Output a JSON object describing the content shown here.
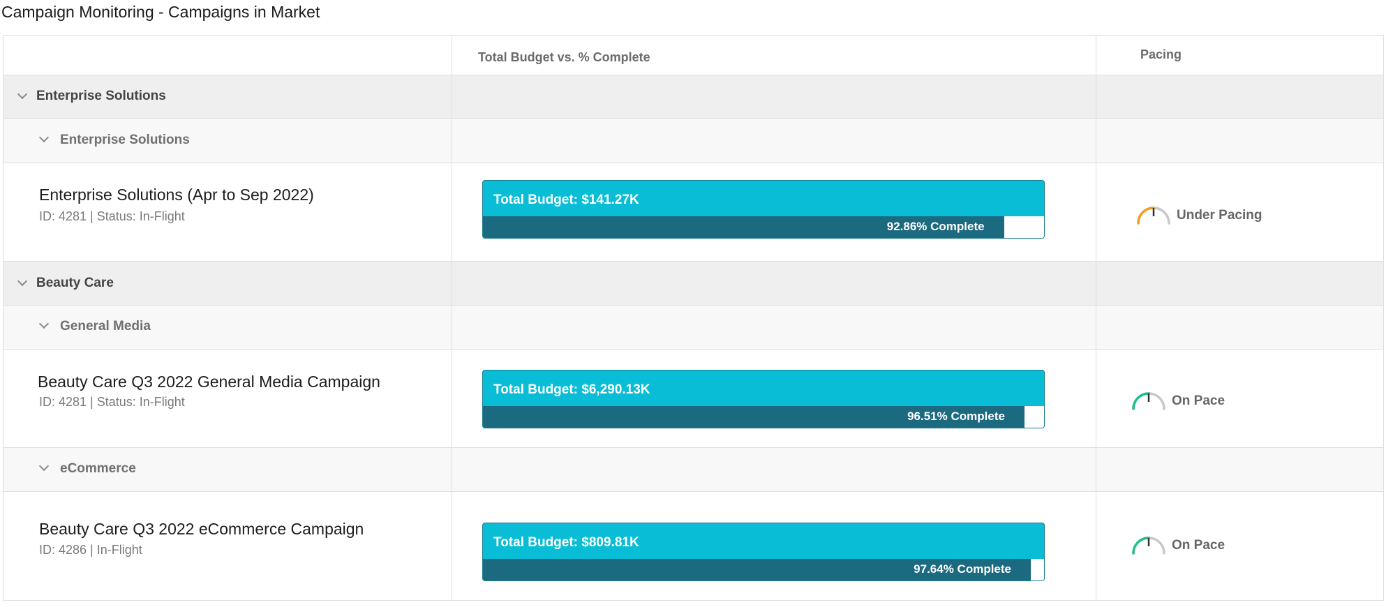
{
  "page": {
    "title": "Campaign Monitoring - Campaigns in Market"
  },
  "columns": {
    "budget_header": "Total Budget vs. % Complete",
    "pacing_header": "Pacing"
  },
  "groups": [
    {
      "label": "Enterprise Solutions",
      "subgroups": [
        {
          "label": "Enterprise Solutions",
          "campaigns": [
            {
              "name": "Enterprise Solutions (Apr to Sep 2022)",
              "meta": "ID: 4281 | Status: In-Flight",
              "budget_label": "Total Budget: $141.27K",
              "percent_complete": 92.86,
              "percent_label": "92.86% Complete",
              "pacing": "Under Pacing",
              "pacing_color": "#f39c1f"
            }
          ]
        }
      ]
    },
    {
      "label": "Beauty Care",
      "subgroups": [
        {
          "label": "General Media",
          "campaigns": [
            {
              "name": "Beauty Care Q3 2022 General Media Campaign",
              "meta": "ID: 4281 | Status: In-Flight",
              "budget_label": "Total Budget: $6,290.13K",
              "percent_complete": 96.51,
              "percent_label": "96.51% Complete",
              "pacing": "On Pace",
              "pacing_color": "#1fbf8f"
            }
          ]
        },
        {
          "label": "eCommerce",
          "campaigns": [
            {
              "name": "Beauty Care Q3 2022 eCommerce Campaign",
              "meta": "ID: 4286 | In-Flight",
              "budget_label": "Total Budget: $809.81K",
              "percent_complete": 97.64,
              "percent_label": "97.64% Complete",
              "pacing": "On Pace",
              "pacing_color": "#1fbf8f"
            }
          ]
        }
      ]
    }
  ],
  "colors": {
    "budget_bar": "#08bdd5",
    "progress_fill": "#1b6a80",
    "gauge_track": "#c8c8c8",
    "gauge_needle": "#333333"
  }
}
